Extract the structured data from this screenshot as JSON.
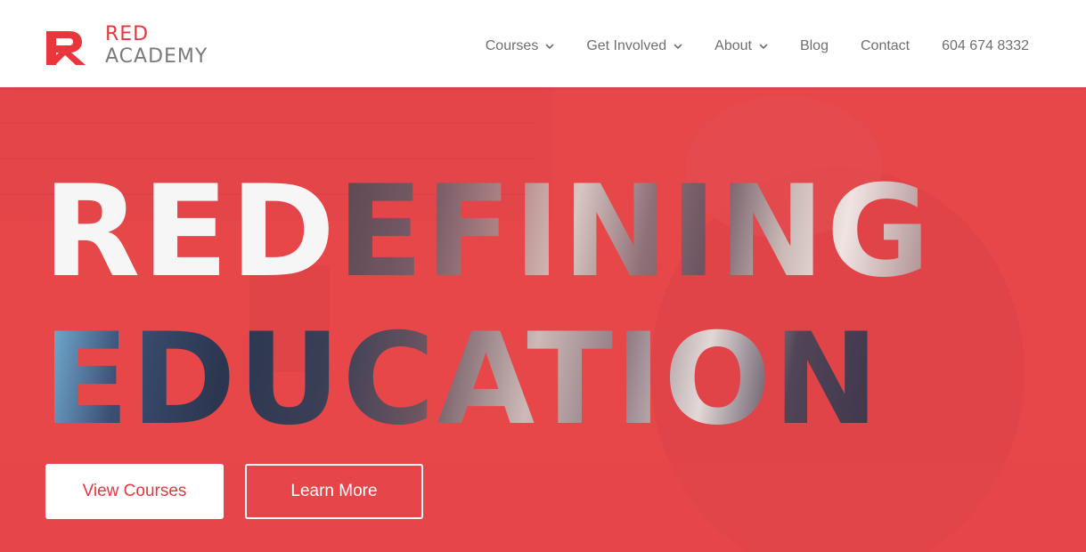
{
  "brand": {
    "name_line1": "RED",
    "name_line2": "ACADEMY",
    "primary_color": "#e8363d",
    "secondary_color": "#7a7a7a"
  },
  "nav": {
    "items": [
      {
        "label": "Courses",
        "has_dropdown": true
      },
      {
        "label": "Get Involved",
        "has_dropdown": true
      },
      {
        "label": "About",
        "has_dropdown": true
      },
      {
        "label": "Blog",
        "has_dropdown": false
      },
      {
        "label": "Contact",
        "has_dropdown": false
      },
      {
        "label": "604 674 8332",
        "has_dropdown": false
      }
    ],
    "dropdown_icon": "chevron-down-icon"
  },
  "hero": {
    "headline_line1_highlight": "RED",
    "headline_line1_rest": "EFINING",
    "headline_line2": "EDUCATION",
    "primary_button": "View Courses",
    "secondary_button": "Learn More",
    "overlay_color": "#e8474a"
  }
}
